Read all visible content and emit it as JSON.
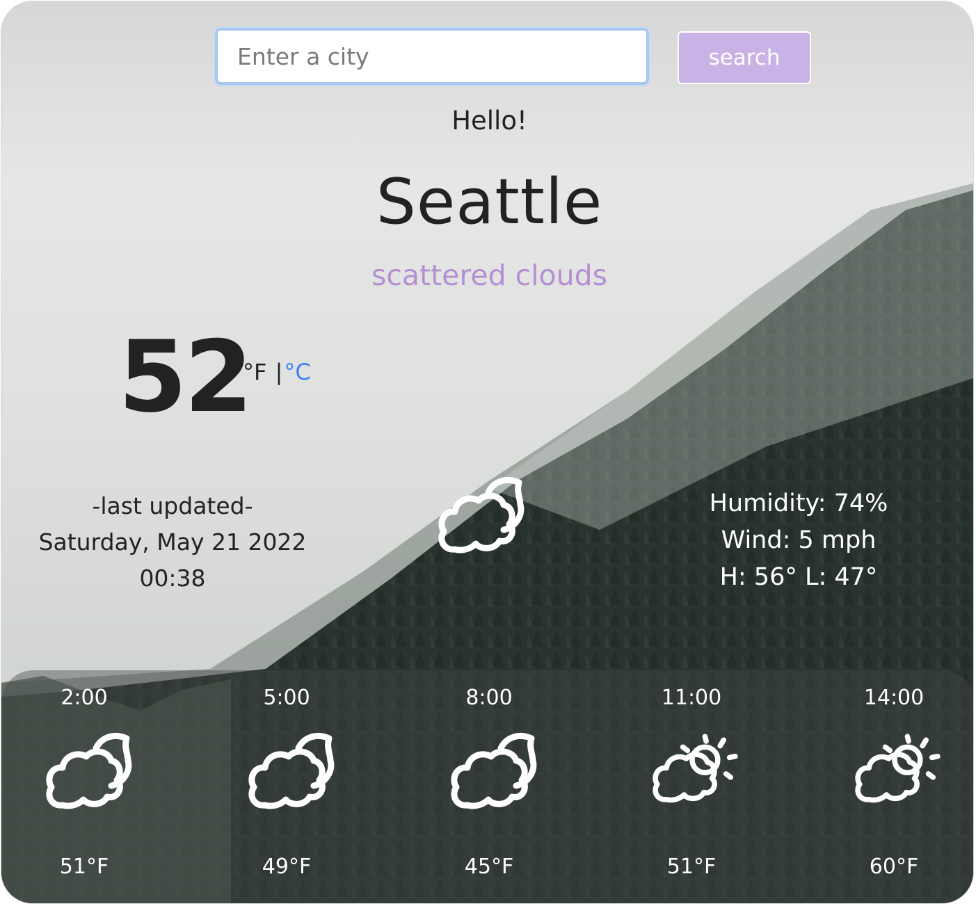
{
  "search": {
    "placeholder": "Enter a city",
    "button_label": "search"
  },
  "greeting": "Hello!",
  "city": "Seattle",
  "description": "scattered clouds",
  "current": {
    "temperature": "52",
    "unit_f": "°F",
    "unit_separator": "|",
    "unit_c": "°C",
    "icon": "cloud-moon-icon"
  },
  "last_updated": {
    "label": "-last updated-",
    "date": "Saturday, May 21 2022",
    "time": "00:38"
  },
  "details": {
    "humidity": "Humidity: 74%",
    "wind": "Wind: 5 mph",
    "high_low": "H: 56°  L: 47°"
  },
  "forecast": [
    {
      "time": "2:00",
      "temp": "51°F",
      "icon": "cloud-moon-icon"
    },
    {
      "time": "5:00",
      "temp": "49°F",
      "icon": "cloud-moon-icon"
    },
    {
      "time": "8:00",
      "temp": "45°F",
      "icon": "cloud-moon-icon"
    },
    {
      "time": "11:00",
      "temp": "51°F",
      "icon": "cloud-sun-icon"
    },
    {
      "time": "14:00",
      "temp": "60°F",
      "icon": "cloud-sun-icon"
    }
  ],
  "colors": {
    "accent": "#c9b3e6",
    "description": "#b48fd4",
    "celsius_link": "#3b82f6"
  }
}
